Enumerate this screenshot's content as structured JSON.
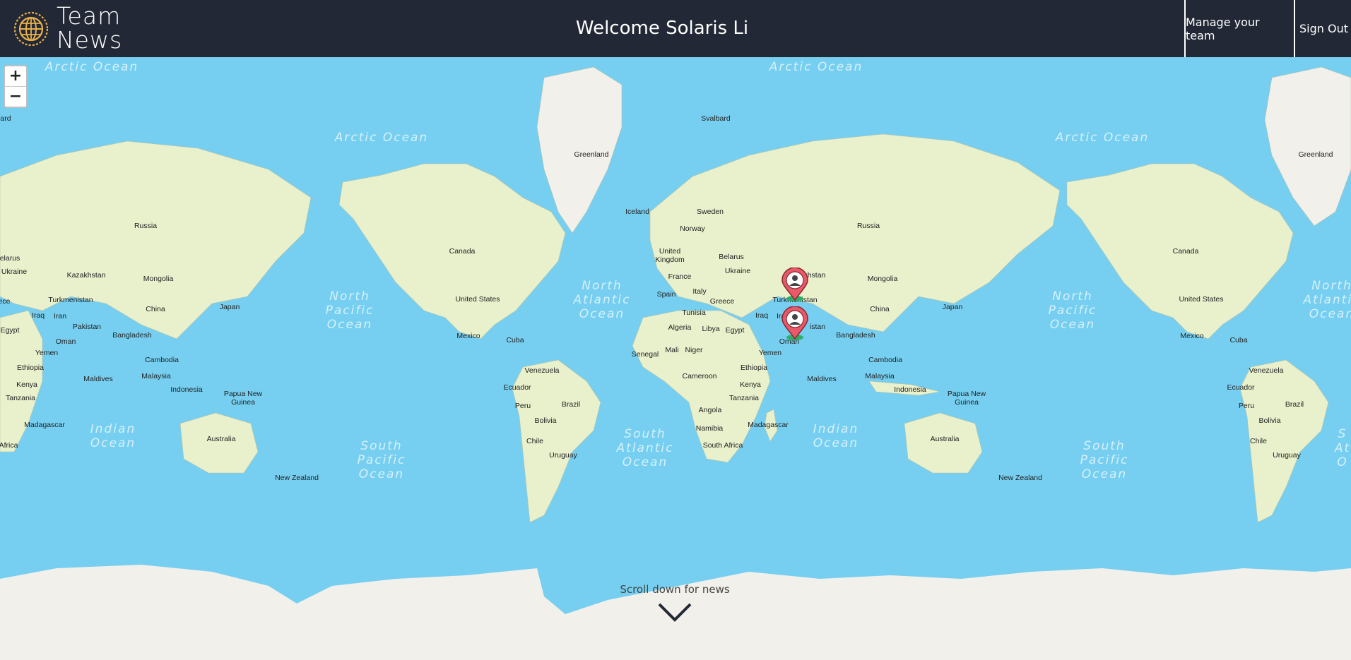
{
  "header": {
    "brand_line1": "Team",
    "brand_line2": "News",
    "welcome": "Welcome Solaris Li",
    "manage_label": "Manage your team",
    "signout_label": "Sign Out"
  },
  "map": {
    "zoom_in": "+",
    "zoom_out": "−",
    "scroll_hint": "Scroll down for news",
    "markers": [
      "member-marker",
      "member-marker"
    ],
    "colors": {
      "ocean": "#76CFF0",
      "land": "#E8F0CC",
      "header": "#222835",
      "marker": "#E85A6A",
      "marker_base": "#2EAE6B"
    }
  },
  "labels": {
    "arctic1": "Arctic Ocean",
    "arctic2": "Arctic Ocean",
    "arctic3": "Arctic Ocean",
    "arctic4": "Arctic Ocean",
    "greenland1": "Greenland",
    "greenland2": "Greenland",
    "svalbard": "Svalbard",
    "iceland": "Iceland",
    "sweden": "Sweden",
    "norway": "Norway",
    "uk": "United Kingdom",
    "belarus1": "Belarus",
    "belarus_l": "elarus",
    "ukraine1": "Ukraine",
    "ukraine2": "Ukraine",
    "france": "France",
    "italy": "Italy",
    "spain": "Spain",
    "greece": "Greece",
    "russia1": "Russia",
    "russia2": "Russia",
    "canada1": "Canada",
    "canada2": "Canada",
    "us1": "United States",
    "us2": "United States",
    "mexico1": "Mexico",
    "mexico2": "Mexico",
    "cuba1": "Cuba",
    "cuba2": "Cuba",
    "kaz1": "Kazakhstan",
    "kaz2": "akhstan",
    "mongolia1": "Mongolia",
    "mongolia2": "Mongolia",
    "turkmen1": "Turkmenistan",
    "turkmen2": "Turkmenistan",
    "china1": "China",
    "china2": "China",
    "japan1": "Japan",
    "japan2": "Japan",
    "iraq1": "Iraq",
    "iraq2": "Iraq",
    "iran1": "Iran",
    "iran2": "Iran",
    "pakistan1": "Pakistan",
    "pakistan2": "istan",
    "bangladesh1": "Bangladesh",
    "bangladesh2": "Bangladesh",
    "oman1": "Oman",
    "oman2": "Oman",
    "yemen1": "Yemen",
    "yemen2": "Yemen",
    "egypt1": "Egypt",
    "egypt2": "Egypt",
    "ece": "ece",
    "ard": "ard",
    "cambodia1": "Cambodia",
    "cambodia2": "Cambodia",
    "malaysia1": "Malaysia",
    "malaysia2": "Malaysia",
    "maldives1": "Maldives",
    "maldives2": "Maldives",
    "indonesia1": "Indonesia",
    "indonesia2": "Indonesia",
    "png1": "Papua New Guinea",
    "png2": "Papua New Guinea",
    "ethiopia1": "Ethiopia",
    "ethiopia2": "Ethiopia",
    "kenya1": "Kenya",
    "kenya2": "Kenya",
    "tanzania1": "Tanzania",
    "tanzania2": "Tanzania",
    "madagascar1": "Madagascar",
    "madagascar2": "Madagascar",
    "africa": "Africa",
    "southafrica": "South Africa",
    "angola": "Angola",
    "namibia": "Namibia",
    "tunisia": "Tunisia",
    "algeria": "Algeria",
    "libya": "Libya",
    "senegal": "Senegal",
    "mali": "Mali",
    "niger": "Niger",
    "cameroon": "Cameroon",
    "venezuela1": "Venezuela",
    "venezuela2": "Venezuela",
    "ecuador1": "Ecuador",
    "ecuador2": "Ecuador",
    "peru1": "Peru",
    "peru2": "Peru",
    "brazil1": "Brazil",
    "brazil2": "Brazil",
    "bolivia1": "Bolivia",
    "bolivia2": "Bolivia",
    "chile1": "Chile",
    "chile2": "Chile",
    "uruguay1": "Uruguay",
    "uruguay2": "Uruguay",
    "australia1": "Australia",
    "australia2": "Australia",
    "nz1": "New Zealand",
    "nz2": "New Zealand",
    "npo1": "North\nPacific\nOcean",
    "npo2": "North\nPacific\nOcean",
    "nao1": "North\nAtlantic\nOcean",
    "nao2": "North\nAtlantic\nOcean",
    "io1": "Indian\nOcean",
    "io2": "Indian\nOcean",
    "spo1": "South\nPacific\nOcean",
    "spo2": "South\nPacific\nOcean",
    "sao1": "South\nAtlantic\nOcean",
    "sao2": "S\nAt\nO"
  }
}
